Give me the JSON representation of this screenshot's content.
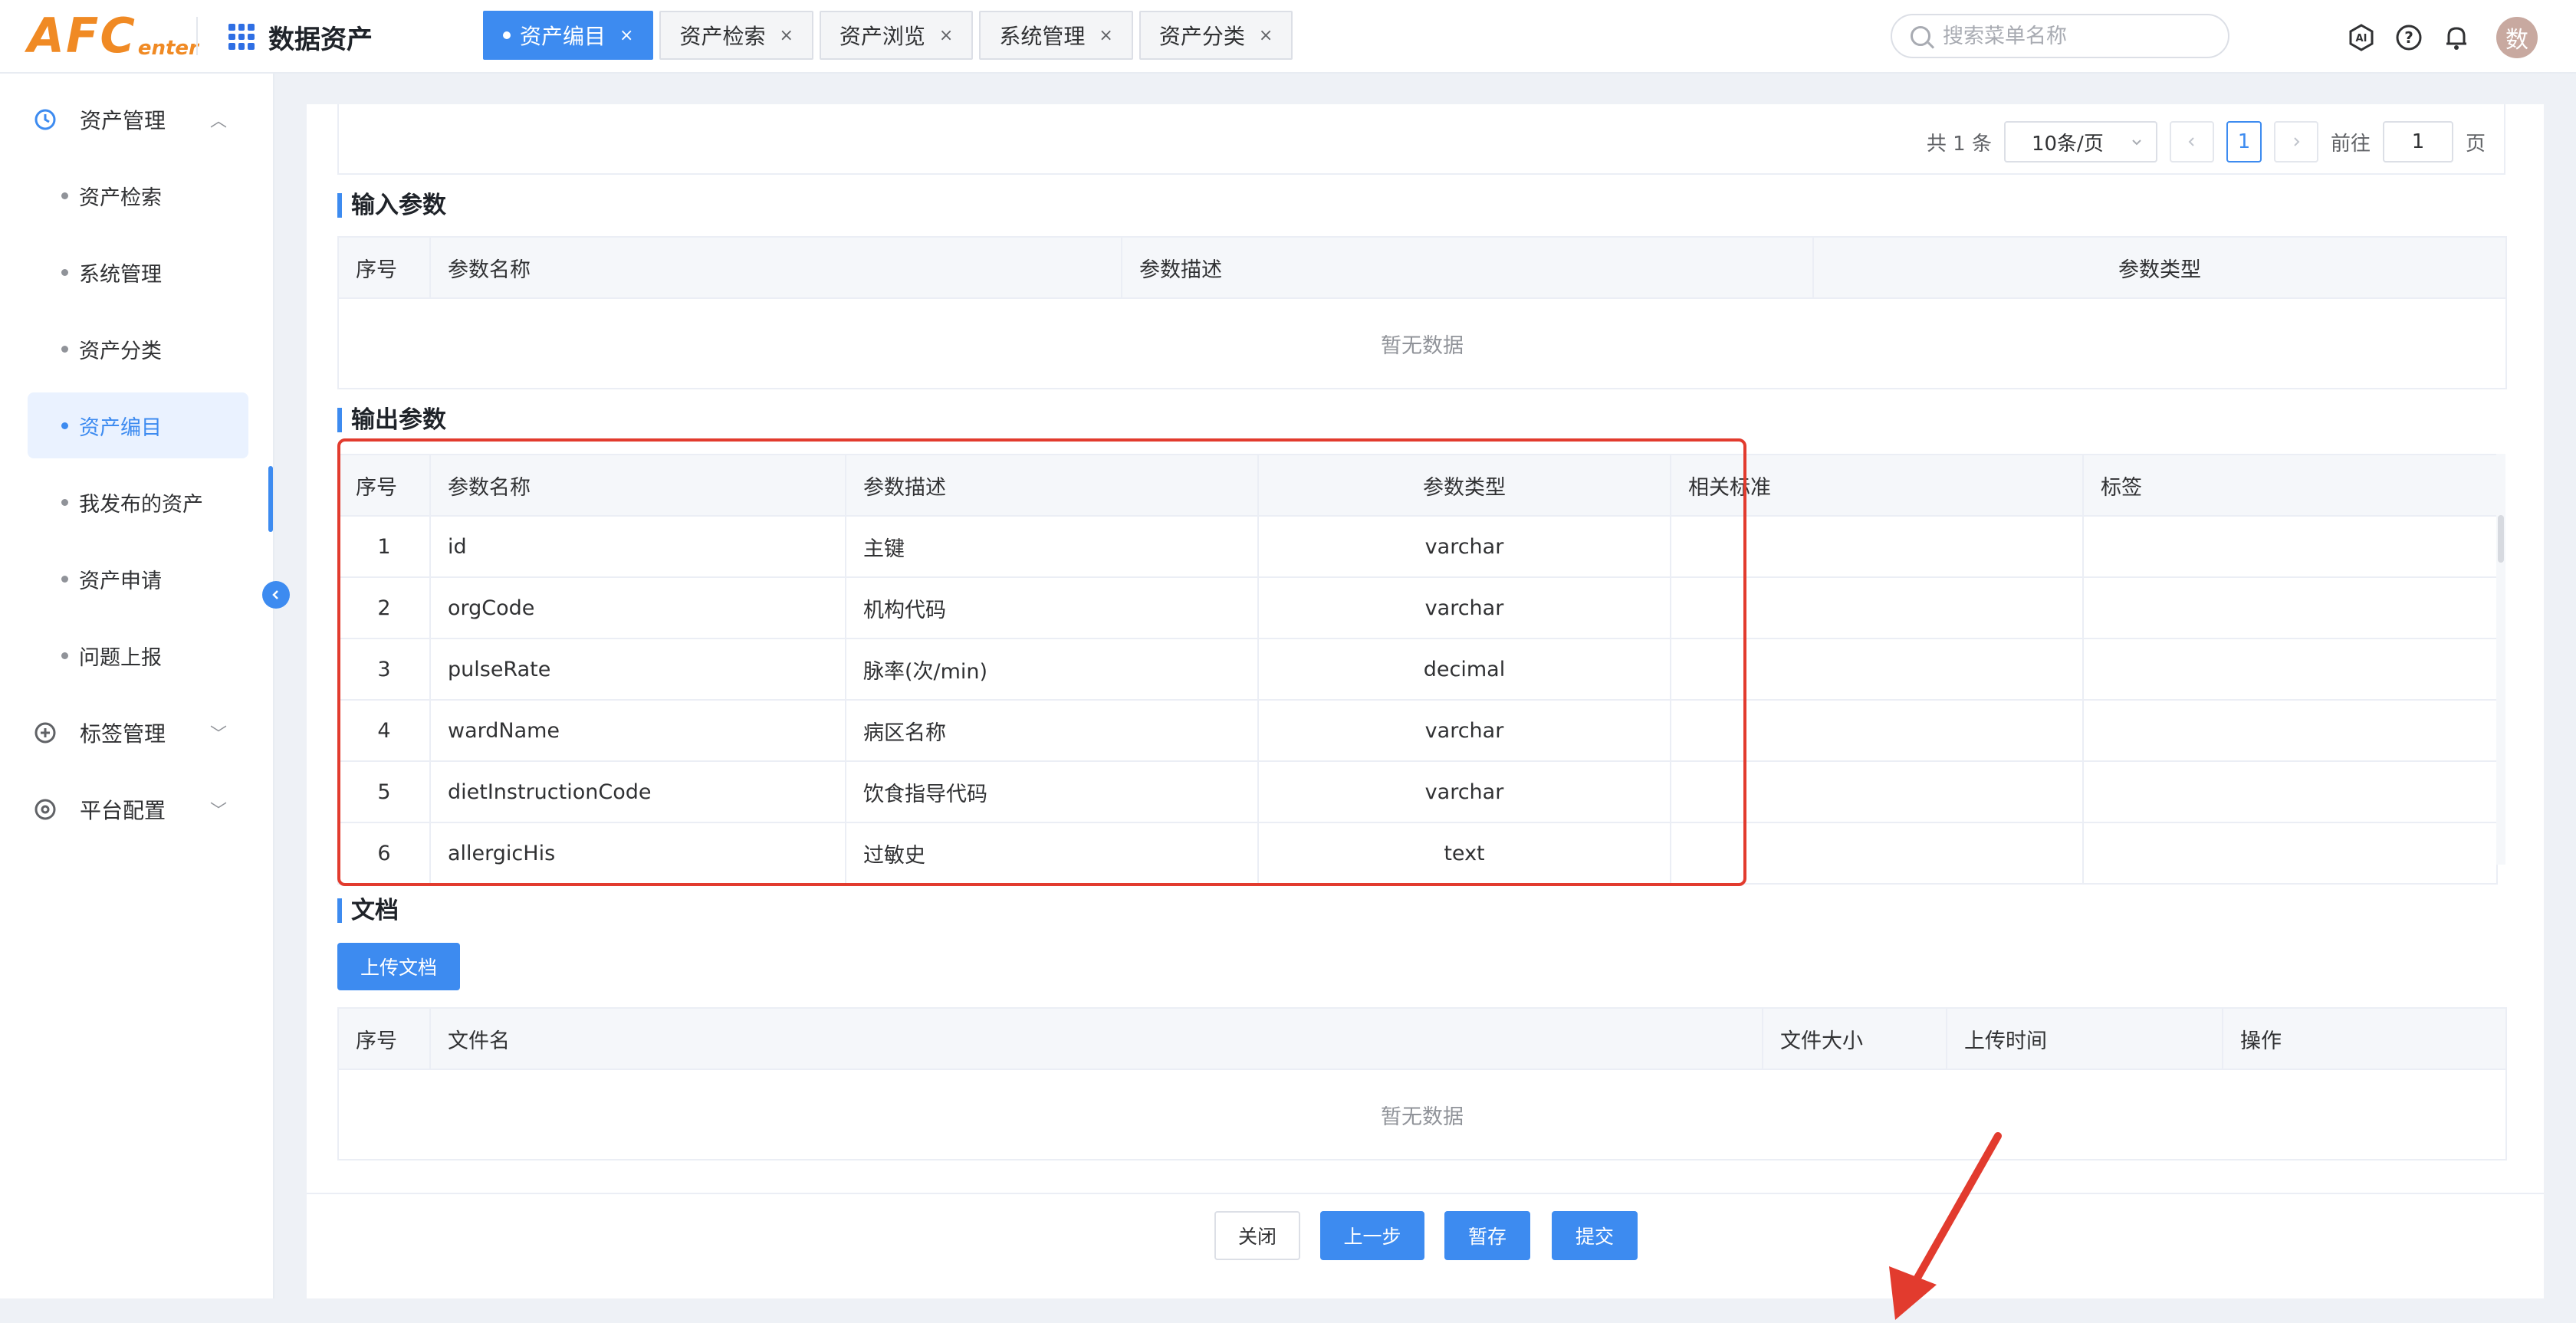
{
  "header": {
    "logo_big": "AFC",
    "logo_small": "enter",
    "app_title": "数据资产",
    "tabs": [
      {
        "label": "资产编目",
        "active": true
      },
      {
        "label": "资产检索"
      },
      {
        "label": "资产浏览"
      },
      {
        "label": "系统管理"
      },
      {
        "label": "资产分类"
      }
    ],
    "tab_close": "×",
    "search_placeholder": "搜索菜单名称",
    "avatar": "数"
  },
  "sidebar": {
    "group_asset": "资产管理",
    "items": [
      "资产检索",
      "系统管理",
      "资产分类",
      "资产编目",
      "我发布的资产",
      "资产申请",
      "问题上报"
    ],
    "group_tag": "标签管理",
    "group_platform": "平台配置"
  },
  "pager": {
    "total": "共 1 条",
    "page_size": "10条/页",
    "current": "1",
    "goto": "前往",
    "goto_value": "1",
    "page_unit": "页"
  },
  "input_params": {
    "title": "输入参数",
    "headers": [
      "序号",
      "参数名称",
      "参数描述",
      "参数类型"
    ],
    "empty": "暂无数据"
  },
  "output_params": {
    "title": "输出参数",
    "headers": [
      "序号",
      "参数名称",
      "参数描述",
      "参数类型",
      "相关标准",
      "标签"
    ],
    "rows": [
      {
        "no": "1",
        "name": "id",
        "desc": "主键",
        "type": "varchar"
      },
      {
        "no": "2",
        "name": "orgCode",
        "desc": "机构代码",
        "type": "varchar"
      },
      {
        "no": "3",
        "name": "pulseRate",
        "desc": "脉率(次/min)",
        "type": "decimal"
      },
      {
        "no": "4",
        "name": "wardName",
        "desc": "病区名称",
        "type": "varchar"
      },
      {
        "no": "5",
        "name": "dietInstructionCode",
        "desc": "饮食指导代码",
        "type": "varchar"
      },
      {
        "no": "6",
        "name": "allergicHis",
        "desc": "过敏史",
        "type": "text"
      }
    ]
  },
  "documents": {
    "title": "文档",
    "upload_label": "上传文档",
    "headers": [
      "序号",
      "文件名",
      "文件大小",
      "上传时间",
      "操作"
    ],
    "empty": "暂无数据"
  },
  "footer": {
    "close": "关闭",
    "prev": "上一步",
    "save": "暂存",
    "submit": "提交"
  },
  "colors": {
    "primary": "#3d8bf0",
    "highlight": "#e23b2e",
    "logo": "#f08a24"
  }
}
